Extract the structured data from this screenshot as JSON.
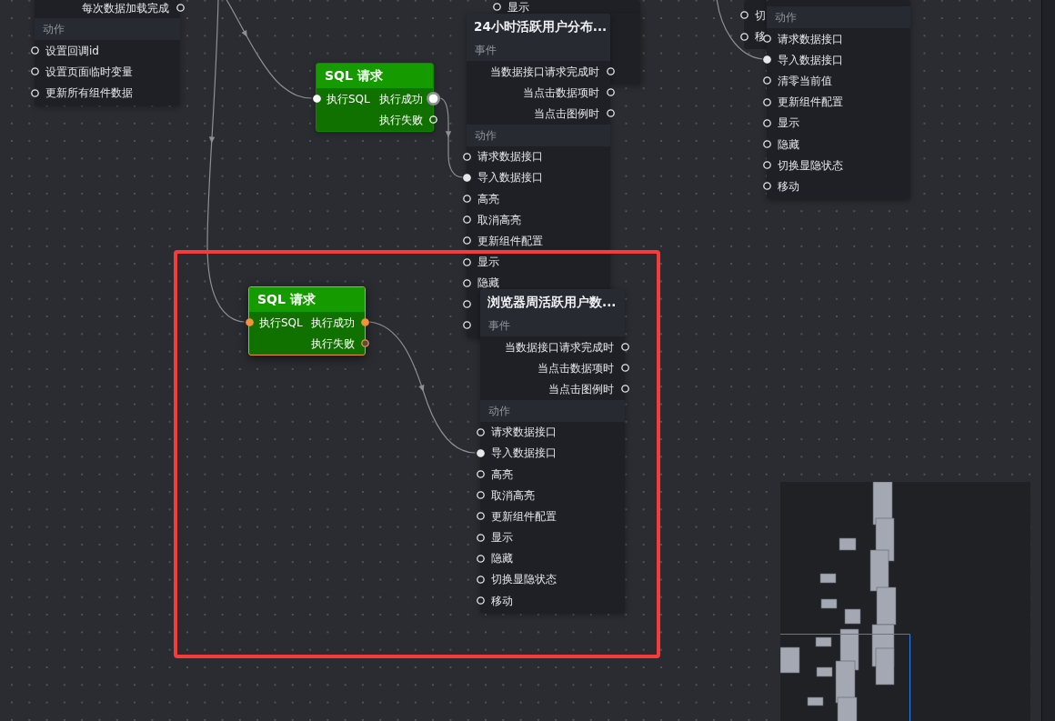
{
  "canvas": {
    "nodes": [
      {
        "kind": "component",
        "rows": [
          {
            "kind": "output",
            "label": "每次数据加载完成",
            "connected": false
          },
          {
            "kind": "heading",
            "label": "动作"
          },
          {
            "kind": "input",
            "label": "设置回调id",
            "connected": false
          },
          {
            "kind": "input",
            "label": "设置页面临时变量",
            "connected": false
          },
          {
            "kind": "input",
            "label": "更新所有组件数据",
            "connected": false
          }
        ]
      },
      {
        "kind": "sql",
        "title": "SQL 请求",
        "selected": false,
        "rows": [
          {
            "input": {
              "label": "执行SQL",
              "connected": true,
              "hovered": false
            },
            "output": {
              "label": "执行成功",
              "connected": true,
              "hovered": true
            }
          },
          {
            "output": {
              "label": "执行失败",
              "connected": false,
              "hovered": false
            }
          }
        ]
      },
      {
        "kind": "component",
        "rows": [
          {
            "kind": "input",
            "label": "显示",
            "connected": false
          }
        ]
      },
      {
        "kind": "component",
        "title": "24小时活跃用户分布...",
        "rows": [
          {
            "kind": "heading",
            "label": "事件"
          },
          {
            "kind": "output",
            "label": "当数据接口请求完成时",
            "connected": false
          },
          {
            "kind": "output",
            "label": "当点击数据项时",
            "connected": false
          },
          {
            "kind": "output",
            "label": "当点击图例时",
            "connected": false
          },
          {
            "kind": "heading",
            "label": "动作"
          },
          {
            "kind": "input",
            "label": "请求数据接口",
            "connected": false
          },
          {
            "kind": "input",
            "label": "导入数据接口",
            "connected": true
          },
          {
            "kind": "input",
            "label": "高亮",
            "connected": false
          },
          {
            "kind": "input",
            "label": "取消高亮",
            "connected": false
          },
          {
            "kind": "input",
            "label": "更新组件配置",
            "connected": false
          },
          {
            "kind": "input",
            "label": "显示",
            "connected": false
          },
          {
            "kind": "input",
            "label": "隐藏",
            "connected": false
          },
          {
            "kind": "input",
            "connected": false
          },
          {
            "kind": "input",
            "connected": false
          }
        ]
      },
      {
        "kind": "component",
        "rows": [
          {
            "kind": "input",
            "label": "切",
            "connected": false
          },
          {
            "kind": "input",
            "label": "移",
            "connected": false
          }
        ]
      },
      {
        "kind": "component",
        "rows": [
          {
            "kind": "heading",
            "label": "动作"
          },
          {
            "kind": "input",
            "label": "请求数据接口",
            "connected": false
          },
          {
            "kind": "input",
            "label": "导入数据接口",
            "connected": true
          },
          {
            "kind": "input",
            "label": "清零当前值",
            "connected": false
          },
          {
            "kind": "input",
            "label": "更新组件配置",
            "connected": false
          },
          {
            "kind": "input",
            "label": "显示",
            "connected": false
          },
          {
            "kind": "input",
            "label": "隐藏",
            "connected": false
          },
          {
            "kind": "input",
            "label": "切换显隐状态",
            "connected": false
          },
          {
            "kind": "input",
            "label": "移动",
            "connected": false
          }
        ]
      },
      {
        "kind": "sql",
        "title": "SQL 请求",
        "selected": true,
        "rows": [
          {
            "input": {
              "label": "执行SQL",
              "connected": true,
              "hovered": false
            },
            "output": {
              "label": "执行成功",
              "connected": true,
              "hovered": false
            }
          },
          {
            "output": {
              "label": "执行失败",
              "connected": false,
              "hovered": false
            }
          }
        ]
      },
      {
        "kind": "component",
        "title": "浏览器周活跃用户数...",
        "rows": [
          {
            "kind": "heading",
            "label": "事件"
          },
          {
            "kind": "output",
            "label": "当数据接口请求完成时",
            "connected": false
          },
          {
            "kind": "output",
            "label": "当点击数据项时",
            "connected": false
          },
          {
            "kind": "output",
            "label": "当点击图例时",
            "connected": false
          },
          {
            "kind": "heading",
            "label": "动作"
          },
          {
            "kind": "input",
            "label": "请求数据接口",
            "connected": false
          },
          {
            "kind": "input",
            "label": "导入数据接口",
            "connected": true
          },
          {
            "kind": "input",
            "label": "高亮",
            "connected": false
          },
          {
            "kind": "input",
            "label": "取消高亮",
            "connected": false
          },
          {
            "kind": "input",
            "label": "更新组件配置",
            "connected": false
          },
          {
            "kind": "input",
            "label": "显示",
            "connected": false
          },
          {
            "kind": "input",
            "label": "隐藏",
            "connected": false
          },
          {
            "kind": "input",
            "label": "切换显隐状态",
            "connected": false
          },
          {
            "kind": "input",
            "label": "移动",
            "connected": false
          }
        ]
      }
    ]
  }
}
